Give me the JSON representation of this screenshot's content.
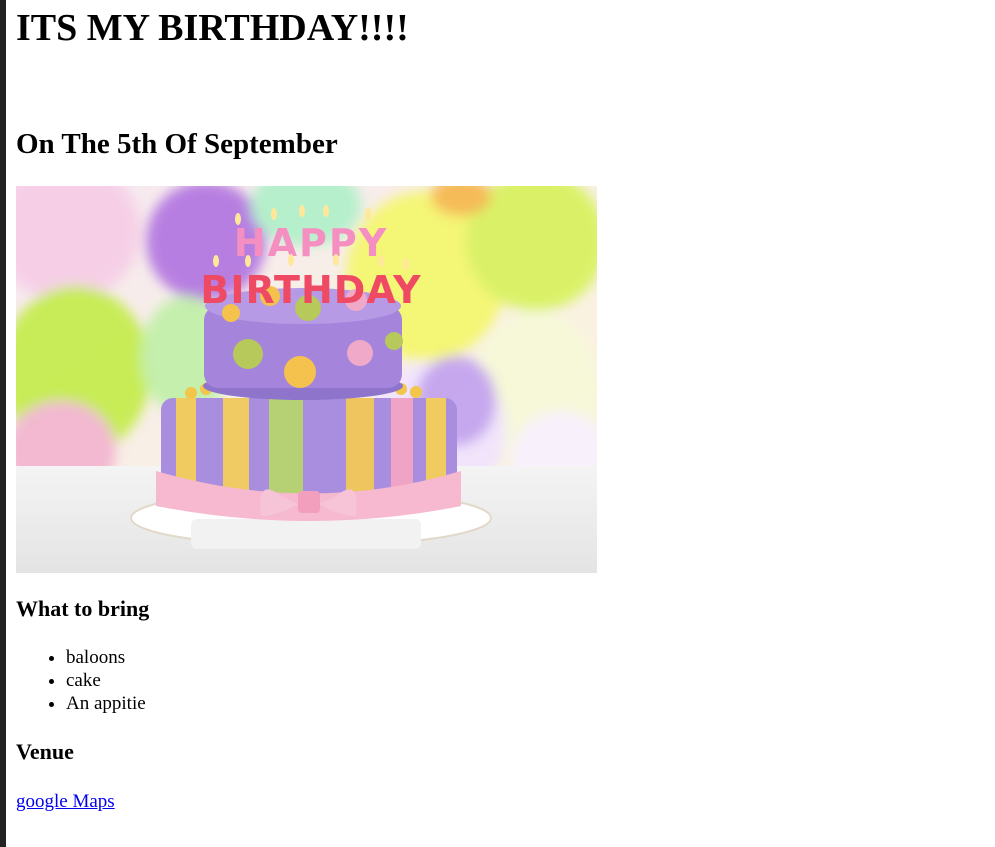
{
  "page": {
    "title": "ITS MY BIRTHDAY!!!!",
    "date_heading": "On The 5th Of September"
  },
  "image": {
    "description_icon": "birthday-cake-image",
    "cake_text_top": "HAPPY",
    "cake_text_bottom": "BIRTHDAY"
  },
  "bring": {
    "heading": "What to bring",
    "items": [
      "baloons",
      "cake",
      "An appitie"
    ]
  },
  "venue": {
    "heading": "Venue",
    "link_text": "google Maps"
  }
}
